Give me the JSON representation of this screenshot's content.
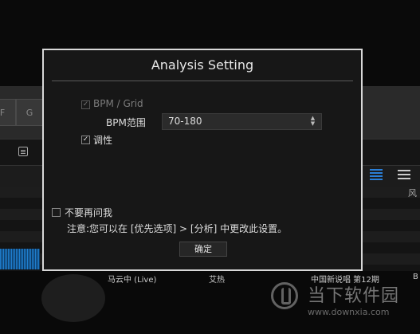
{
  "background_app": {
    "key_buttons": [
      "F",
      "G"
    ],
    "column_header_partial": "风",
    "track_row": {
      "title": "马云中 (Live)",
      "artist": "艾热",
      "album": "中国新说唱 第12期",
      "extra": "B"
    }
  },
  "dialog": {
    "title": "Analysis Setting",
    "bpm_grid_label": "BPM / Grid",
    "bpm_grid_checked": true,
    "bpm_range_label": "BPM范围",
    "bpm_range_value": "70-180",
    "key_label": "调性",
    "key_checked": true,
    "dont_ask_label": "不要再问我",
    "dont_ask_checked": false,
    "note_text": "注意:您可以在 [优先选项] > [分析] 中更改此设置。",
    "ok_label": "确定"
  },
  "watermark": {
    "name": "当下软件园",
    "url": "www.downxia.com"
  },
  "colors": {
    "dialog_border": "#d8d8d8",
    "dialog_bg": "#171717",
    "accent_blue": "#2a7fd8"
  }
}
